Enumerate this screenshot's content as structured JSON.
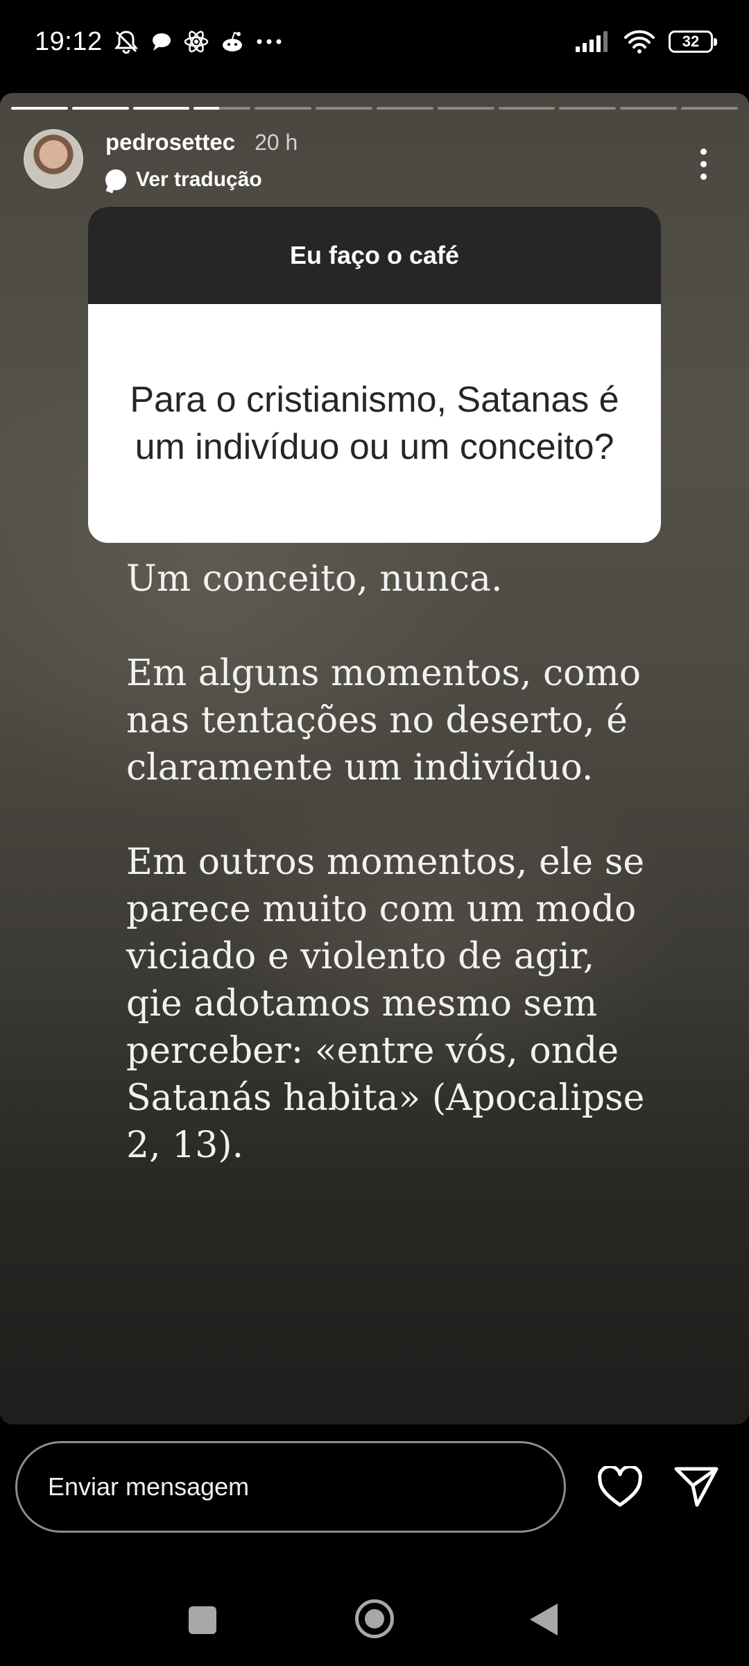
{
  "status_bar": {
    "time": "19:12",
    "battery": "32",
    "icons": [
      "muted-bell-icon",
      "chat-bubble-icon",
      "atom-icon",
      "reddit-icon",
      "more-dots-icon",
      "signal-icon",
      "wifi-icon",
      "battery-icon"
    ]
  },
  "story": {
    "segments_total": 12,
    "segments_completed": 3,
    "current_segment_progress": 0.45,
    "username": "pedrosettec",
    "time_ago": "20 h",
    "translate_label": "Ver tradução",
    "question": {
      "header": "Eu faço o café",
      "text": "Para o cristianismo, Satanas é um indivíduo ou um conceito?"
    },
    "answer": {
      "p1": "Um conceito, nunca.",
      "p2": "Em alguns momentos, como nas tentações no deserto, é claramente um indivíduo.",
      "p3": "Em outros momentos, ele se parece muito com um modo viciado e violento de agir, qie adotamos mesmo sem perceber: «entre vós, onde Satanás habita» (Apocalipse 2, 13)."
    }
  },
  "reply": {
    "placeholder": "Enviar mensagem"
  },
  "colors": {
    "card_header": "#262626",
    "card_body": "#ffffff",
    "background": "#000000"
  }
}
